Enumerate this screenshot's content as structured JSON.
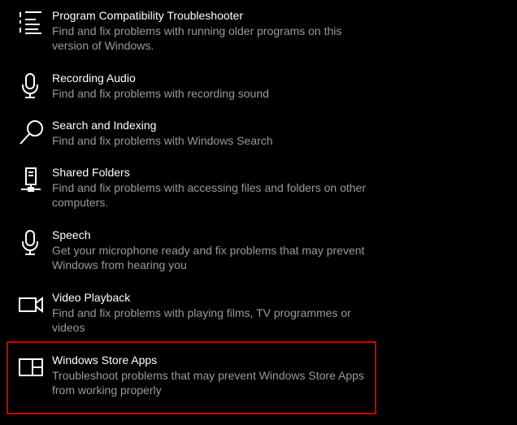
{
  "troubleshooters": [
    {
      "title": "Program Compatibility Troubleshooter",
      "description": "Find and fix problems with running older programs on this version of Windows.",
      "icon": "list-icon"
    },
    {
      "title": "Recording Audio",
      "description": "Find and fix problems with recording sound",
      "icon": "microphone-icon"
    },
    {
      "title": "Search and Indexing",
      "description": "Find and fix problems with Windows Search",
      "icon": "search-icon"
    },
    {
      "title": "Shared Folders",
      "description": "Find and fix problems with accessing files and folders on other computers.",
      "icon": "network-computer-icon"
    },
    {
      "title": "Speech",
      "description": "Get your microphone ready and fix problems that may prevent Windows from hearing you",
      "icon": "microphone-icon"
    },
    {
      "title": "Video Playback",
      "description": "Find and fix problems with playing films, TV programmes or videos",
      "icon": "video-camera-icon"
    },
    {
      "title": "Windows Store Apps",
      "description": "Troubleshoot problems that may prevent Windows Store Apps from working properly",
      "icon": "store-apps-icon"
    }
  ],
  "colors": {
    "background": "#000000",
    "title": "#ffffff",
    "description": "#9a9a9a",
    "highlight_border": "#d10000"
  }
}
